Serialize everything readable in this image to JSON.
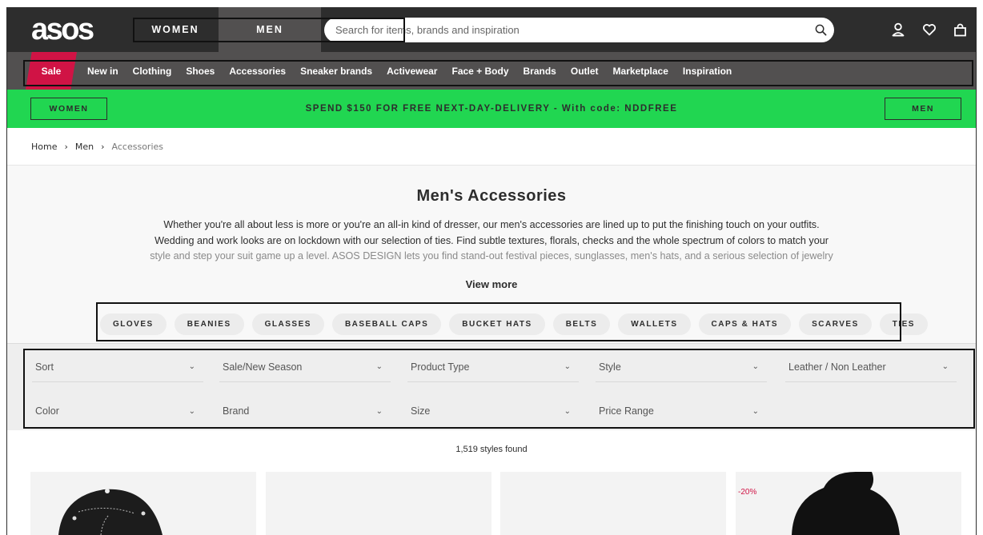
{
  "header": {
    "logo": "asos",
    "gender_tabs": [
      "WOMEN",
      "MEN"
    ],
    "search_placeholder": "Search for items, brands and inspiration",
    "icons": [
      "search-icon",
      "account-icon",
      "heart-icon",
      "bag-icon"
    ],
    "bg_color": "#2d2d2d",
    "active_tab_color": "#525050"
  },
  "nav": {
    "sale_label": "Sale",
    "sale_color": "#d01345",
    "items": [
      "New in",
      "Clothing",
      "Shoes",
      "Accessories",
      "Sneaker brands",
      "Activewear",
      "Face + Body",
      "Brands",
      "Outlet",
      "Marketplace",
      "Inspiration"
    ]
  },
  "promo": {
    "women_label": "WOMEN",
    "men_label": "MEN",
    "text": "SPEND $150 FOR FREE NEXT-DAY-DELIVERY - With code: NDDFREE",
    "bg_color": "#21d651"
  },
  "breadcrumb": {
    "items": [
      "Home",
      "Men",
      "Accessories"
    ]
  },
  "intro": {
    "title": "Men's Accessories",
    "line1": "Whether you're all about less is more or you're an all-in kind of dresser, our men's accessories are lined up to put the finishing touch on your outfits.",
    "line2": "Wedding and work looks are on lockdown with our selection of ties. Find subtle textures, florals, checks and the whole spectrum of colors to match your",
    "line3": "style and step your suit game up a level. ASOS DESIGN lets you find stand-out festival pieces, sunglasses, men's hats, and a serious selection of jewelry",
    "view_more": "View more"
  },
  "pills": [
    "GLOVES",
    "BEANIES",
    "GLASSES",
    "BASEBALL CAPS",
    "BUCKET HATS",
    "BELTS",
    "WALLETS",
    "CAPS & HATS",
    "SCARVES",
    "TIES"
  ],
  "filters": {
    "row1": [
      "Sort",
      "Sale/New Season",
      "Product Type",
      "Style",
      "Leather / Non Leather"
    ],
    "row2": [
      "Color",
      "Brand",
      "Size",
      "Price Range"
    ]
  },
  "results": {
    "count": "1,519 styles found",
    "discount_badge": "-20%"
  }
}
